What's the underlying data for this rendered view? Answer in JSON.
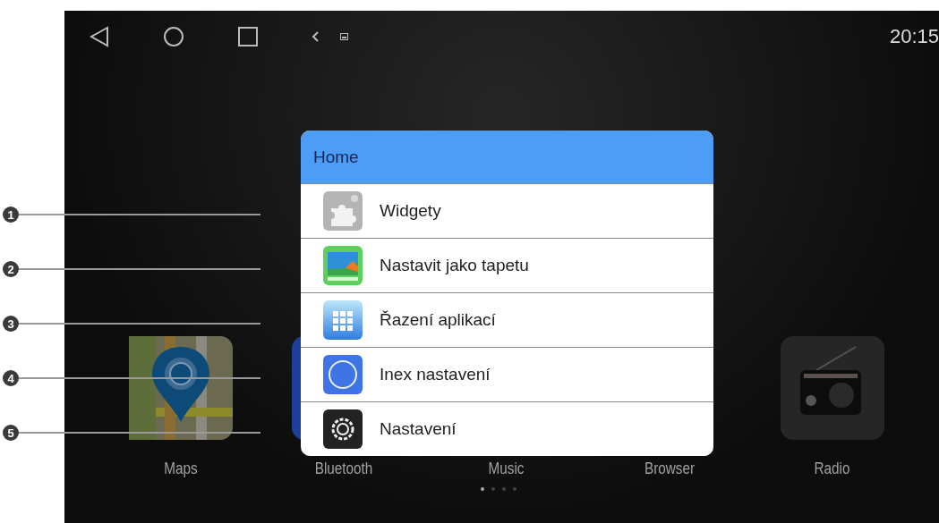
{
  "status_bar": {
    "time": "20:15"
  },
  "dialog": {
    "title": "Home",
    "items": [
      {
        "label": "Widgety",
        "kind": "widgets"
      },
      {
        "label": "Nastavit jako tapetu",
        "kind": "wallpaper"
      },
      {
        "label": "Řazení aplikací",
        "kind": "grid"
      },
      {
        "label": "Inex nastavení",
        "kind": "circle"
      },
      {
        "label": "Nastavení",
        "kind": "settings"
      }
    ]
  },
  "apps": [
    {
      "label": "Maps",
      "kind": "maps"
    },
    {
      "label": "Bluetooth",
      "kind": "bluetooth"
    },
    {
      "label": "Music"
    },
    {
      "label": "Browser"
    },
    {
      "label": "Radio",
      "kind": "radio"
    }
  ],
  "page_dots": [
    {
      "selected": true
    },
    {
      "selected": false
    },
    {
      "selected": false
    },
    {
      "selected": false
    }
  ],
  "callouts": [
    "1",
    "2",
    "3",
    "4",
    "5"
  ]
}
